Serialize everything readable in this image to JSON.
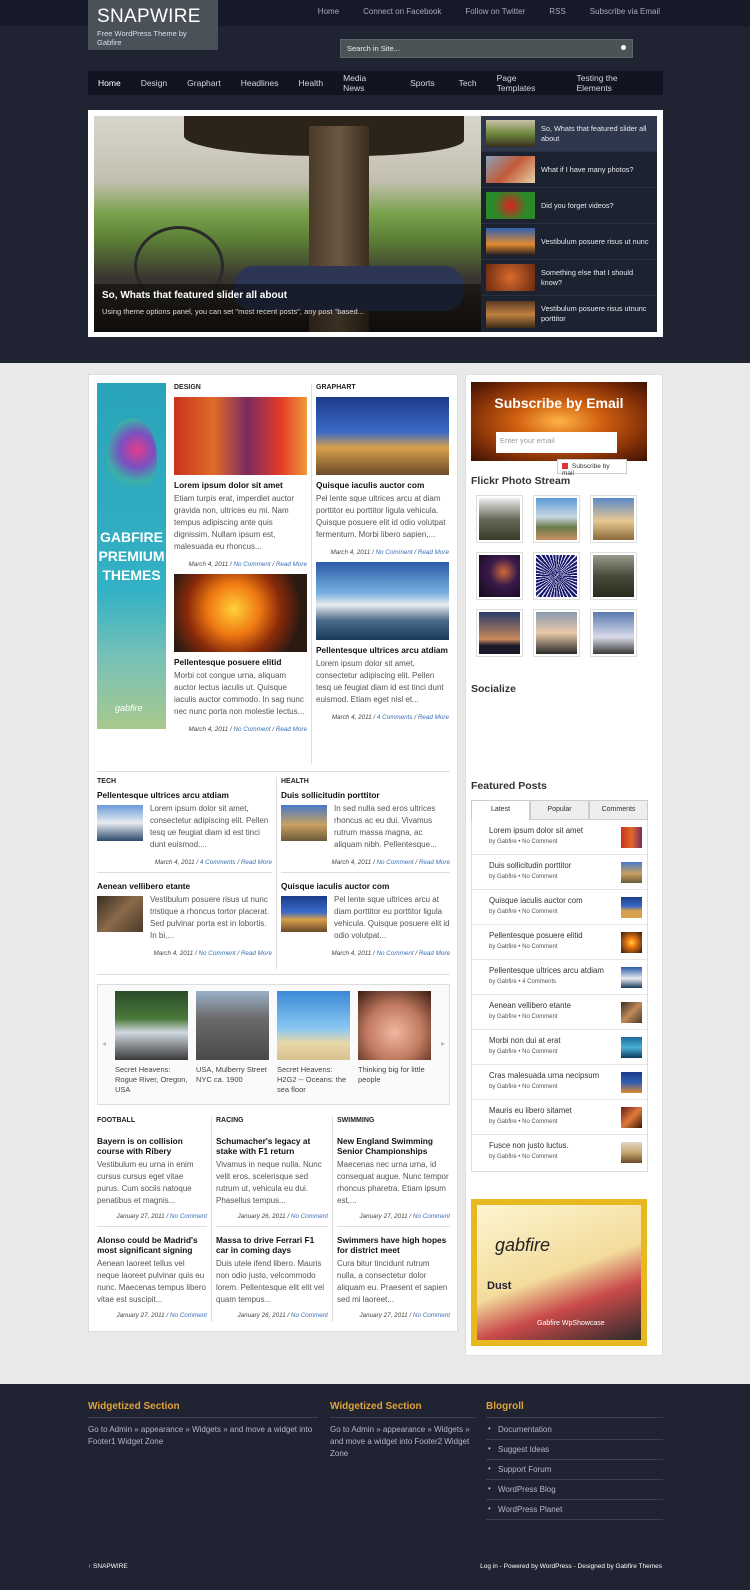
{
  "site": {
    "title": "SNAPWIRE",
    "tagline": "Free WordPress Theme by Gabfire"
  },
  "toplinks": [
    "Home",
    "Connect on Facebook",
    "Follow on Twitter",
    "RSS",
    "Subscribe via Email"
  ],
  "search": {
    "placeholder": "Search in Site..."
  },
  "nav": [
    "Home",
    "Design",
    "Graphart",
    "Headlines",
    "Health",
    "Media News",
    "Sports",
    "Tech",
    "Page Templates",
    "Testing the Elements"
  ],
  "slider": {
    "caption_title": "So, Whats that featured slider all about",
    "caption_text": "Using theme options panel, you can set \"most recent posts\", any post \"based...",
    "items": [
      "So, Whats that featured slider all about",
      "What if I have many photos?",
      "Did you forget videos?",
      "Vestibulum posuere risus ut nunc",
      "Something else that I should know?",
      "Vestibulum posuere risus utnunc porttitor"
    ]
  },
  "ad_left": {
    "text1": "GABFIRE",
    "text2": "PREMIUM",
    "text3": "THEMES",
    "brand": "gabfire"
  },
  "sections": {
    "design": {
      "label": "DESIGN",
      "posts": [
        {
          "title": "Lorem ipsum dolor sit amet",
          "excerpt": "Etiam turpis erat, imperdiet auctor gravida non, ultrices eu mi. Nam tempus adipiscing ante quis dignissim. Nullam ipsum est, malesuada eu rhoncus...",
          "date": "March 4, 2011",
          "comments": "No Comment",
          "more": "Read More"
        },
        {
          "title": "Pellentesque posuere elitid",
          "excerpt": "Morbi cot congue urna, aliquam auctor lectus iaculis ut. Quisque iaculis auctor commodo. In sag nunc nec nunc porta non molestie lectus...",
          "date": "March 4, 2011",
          "comments": "No Comment",
          "more": "Read More"
        }
      ]
    },
    "graphart": {
      "label": "GRAPHART",
      "posts": [
        {
          "title": "Quisque iaculis auctor com",
          "excerpt": "Pel lente sque ultrices arcu at diam porttitor eu porttitor ligula vehicula. Quisque posuere elit id odio volutpat fermentum. Morbi libero sapien,...",
          "date": "March 4, 2011",
          "comments": "No Comment",
          "more": "Read More"
        },
        {
          "title": "Pellentesque ultrices arcu atdiam",
          "excerpt": "Lorem ipsum dolor sit amet, consectetur adipiscing elit. Pellen tesq ue feugiat diam id est tinci dunt euismod. Etiam eget nisl et...",
          "date": "March 4, 2011",
          "comments": "4 Comments",
          "more": "Read More"
        }
      ]
    },
    "tech": {
      "label": "TECH",
      "posts": [
        {
          "title": "Pellentesque ultrices arcu atdiam",
          "excerpt": "Lorem ipsum dolor sit amet, consectetur adipiscing elit. Pellen tesq ue feugiat diam id est tinci dunt euismod....",
          "date": "March 4, 2011",
          "comments": "4 Comments",
          "more": "Read More"
        },
        {
          "title": "Aenean vellibero etante",
          "excerpt": "Vestibulum posuere risus ut nunc tristique a rhoncus tortor placerat. Sed pulvinar porta est in lobortis. In bi,...",
          "date": "March 4, 2011",
          "comments": "No Comment",
          "more": "Read More"
        }
      ]
    },
    "health": {
      "label": "HEALTH",
      "posts": [
        {
          "title": "Duis sollicitudin porttitor",
          "excerpt": "In sed nulla sed eros ultrices rhoncus ac eu dui. Vivamus rutrum massa magna, ac aliquam nibh. Pellentesque...",
          "date": "March 4, 2011",
          "comments": "No Comment",
          "more": "Read More"
        },
        {
          "title": "Quisque iaculis auctor com",
          "excerpt": "Pel lente sque ultrices arcu at diam porttitor eu porttitor ligula vehicula. Quisque posuere elit id odio volutpat...",
          "date": "March 4, 2011",
          "comments": "No Comment",
          "more": "Read More"
        }
      ]
    }
  },
  "carousel": [
    "Secret Heavens: Rogue River, Oregon, USA",
    "USA, Mulberry Street NYC ca. 1900",
    "Secret Heavens: H2G2 -- Oceans: the sea floor",
    "Thinking big for little people"
  ],
  "bottom": [
    {
      "label": "FOOTBALL",
      "posts": [
        {
          "title": "Bayern is on collision course with Ribery",
          "excerpt": "Vestibulum eu urna in enim cursus cursus eget vitae purus. Cum sociis natoque penatibus et magnis...",
          "date": "January 27, 2011",
          "comments": "No Comment"
        },
        {
          "title": "Alonso could be Madrid's most significant signing",
          "excerpt": "Aenean laoreet tellus vel neque laoreet pulvinar quis eu nunc. Maecenas tempus libero vitae est suscipit...",
          "date": "January 27, 2011",
          "comments": "No Comment"
        }
      ]
    },
    {
      "label": "RACING",
      "posts": [
        {
          "title": "Schumacher's legacy at stake with F1 return",
          "excerpt": "Vivamus in neque nulla. Nunc velit eros, scelerisque sed rutrum ut, vehicula eu dui. Phasellus tempus...",
          "date": "January 26, 2011",
          "comments": "No Comment"
        },
        {
          "title": "Massa to drive Ferrari F1 car in coming days",
          "excerpt": "Duis utele ifend libero. Mauris non odio justo, velcommodo lorem. Pellentesque elit elit vel quam tempus...",
          "date": "January 26, 2011",
          "comments": "No Comment"
        }
      ]
    },
    {
      "label": "SWIMMING",
      "posts": [
        {
          "title": "New England Swimming Senior Championships",
          "excerpt": "Maecenas nec urna urna, id consequat augue. Nunc tempor rhoncus pharetra. Etiam ipsum est,...",
          "date": "January 27, 2011",
          "comments": "No Comment"
        },
        {
          "title": "Swimmers have high hopes for district meet",
          "excerpt": "Cura bitur tincidunt rutrum nulla, a consectetur dolor aliquam eu. Praesent et sapien sed mi laoreet...",
          "date": "January 27, 2011",
          "comments": "No Comment"
        }
      ]
    }
  ],
  "sidebar": {
    "subscribe_title": "Subscribe by Email",
    "email_placeholder": "Enter your email",
    "subscribe_button": "Subscribe by mail",
    "flickr_title": "Flickr Photo Stream",
    "socialize_title": "Socialize",
    "featured_title": "Featured Posts",
    "tabs": [
      "Latest",
      "Popular",
      "Comments"
    ],
    "featured": [
      {
        "title": "Lorem ipsum dolor sit amet",
        "meta": "by Gabfire • No Comment"
      },
      {
        "title": "Duis sollicitudin porttitor",
        "meta": "by Gabfire • No Comment"
      },
      {
        "title": "Quisque iaculis auctor com",
        "meta": "by Gabfire • No Comment"
      },
      {
        "title": "Pellentesque posuere elitid",
        "meta": "by Gabfire • No Comment"
      },
      {
        "title": "Pellentesque ultrices arcu atdiam",
        "meta": "by Gabfire • 4 Comments"
      },
      {
        "title": "Aenean vellibero etante",
        "meta": "by Gabfire • No Comment"
      },
      {
        "title": "Morbi non dui at erat",
        "meta": "by Gabfire • No Comment"
      },
      {
        "title": "Cras malesuada urna necipsum",
        "meta": "by Gabfire • No Comment"
      },
      {
        "title": "Mauris eu libero sitamet",
        "meta": "by Gabfire • No Comment"
      },
      {
        "title": "Fusce non justo luctus.",
        "meta": "by Gabfire • No Comment"
      }
    ],
    "ad": {
      "brand": "gabfire",
      "dust": "Dust",
      "showcase": "Gabfire WpShowcase"
    }
  },
  "footer": {
    "w1_title": "Widgetized Section",
    "w1_text": "Go to Admin » appearance » Widgets » and move a widget into Footer1 Widget Zone",
    "w2_title": "Widgetized Section",
    "w2_text": "Go to Admin » appearance » Widgets » and move a widget into Footer2 Widget Zone",
    "blogroll_title": "Blogroll",
    "blogroll": [
      "Documentation",
      "Suggest Ideas",
      "Support Forum",
      "WordPress Blog",
      "WordPress Planet"
    ],
    "left": "↑ SNAPWIRE",
    "right": "Log in - Powered by WordPress - Designed by Gabfire Themes"
  }
}
